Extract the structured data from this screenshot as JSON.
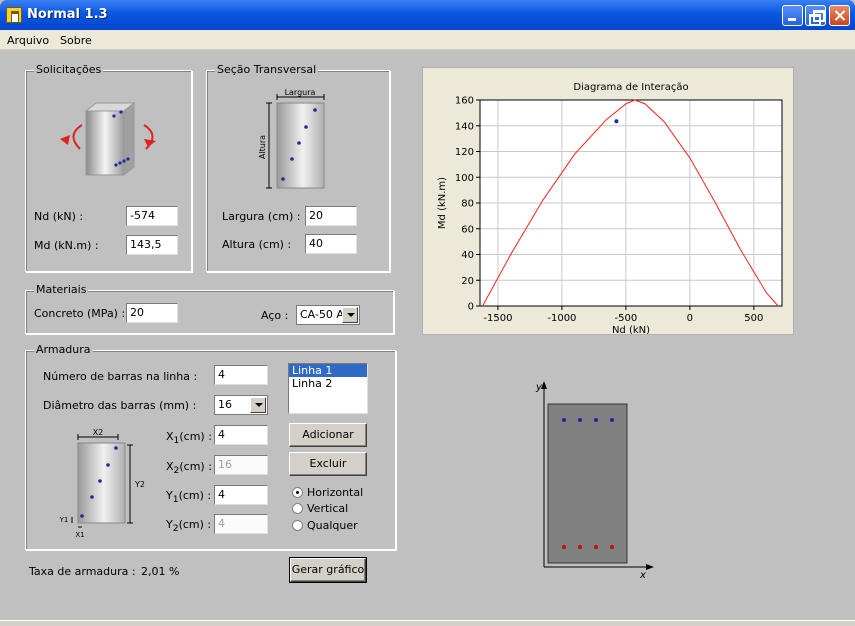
{
  "window": {
    "title": "Normal 1.3"
  },
  "menu": {
    "items": [
      "Arquivo",
      "Sobre"
    ]
  },
  "solicitacoes": {
    "legend": "Solicitações",
    "nd_label": "Nd (kN) :",
    "nd_value": "-574",
    "md_label": "Md (kN.m) :",
    "md_value": "143,5"
  },
  "secao": {
    "legend": "Seção Transversal",
    "diagram_largura": "Largura",
    "diagram_altura": "Altura",
    "largura_label": "Largura (cm) :",
    "largura_value": "20",
    "altura_label": "Altura (cm) :",
    "altura_value": "40"
  },
  "materiais": {
    "legend": "Materiais",
    "concreto_label": "Concreto (MPa) :",
    "concreto_value": "20",
    "aco_label": "Aço :",
    "aco_value": "CA-50 A"
  },
  "armadura": {
    "legend": "Armadura",
    "num_barras_label": "Número de barras na linha :",
    "num_barras_value": "4",
    "diametro_label": "Diâmetro das barras (mm) :",
    "diametro_value": "16",
    "lines": [
      "Linha 1",
      "Linha 2"
    ],
    "x1_sym": "X",
    "x1_sub": "1",
    "x1_suffix": "(cm) :",
    "x1_value": "4",
    "x2_sym": "X",
    "x2_sub": "2",
    "x2_suffix": "(cm) :",
    "x2_value": "16",
    "y1_sym": "Y",
    "y1_sub": "1",
    "y1_suffix": "(cm) :",
    "y1_value": "4",
    "y2_sym": "Y",
    "y2_sub": "2",
    "y2_suffix": "(cm) :",
    "y2_value": "4",
    "diag_x2": "X2",
    "diag_y2": "Y2",
    "diag_y1": "Y1",
    "diag_x1": "X1",
    "adicionar_label": "Adicionar",
    "excluir_label": "Excluir",
    "radio_horizontal": "Horizontal",
    "radio_vertical": "Vertical",
    "radio_qualquer": "Qualquer"
  },
  "taxa": {
    "label": "Taxa de armadura :",
    "value": "2,01 %"
  },
  "gerar_label": "Gerar gráfico",
  "section_view": {
    "y_label": "y",
    "x_label": "x"
  },
  "colors": {
    "accent_red": "#dd2222",
    "bar_blue": "#1f2a9a",
    "bar_red": "#c0101a",
    "section_gray": "#808080"
  },
  "chart_data": {
    "type": "line",
    "title": "Diagrama de Interação",
    "xlabel": "Nd (kN)",
    "ylabel": "Md (kN.m)",
    "xlim": [
      -1640,
      720
    ],
    "ylim": [
      0,
      160
    ],
    "xticks": [
      -1500,
      -1000,
      -500,
      0,
      500
    ],
    "yticks": [
      0,
      20,
      40,
      60,
      80,
      100,
      120,
      140,
      160
    ],
    "grid": true,
    "series": [
      {
        "x": [
          -1620,
          -1400,
          -1150,
          -900,
          -650,
          -500,
          -430,
          -350,
          -200,
          0,
          200,
          400,
          600,
          690
        ],
        "y": [
          0,
          40,
          82,
          118,
          145,
          157,
          160,
          157,
          143,
          115,
          80,
          43,
          10,
          0
        ]
      }
    ],
    "point": {
      "x": -574,
      "y": 143.5
    }
  }
}
